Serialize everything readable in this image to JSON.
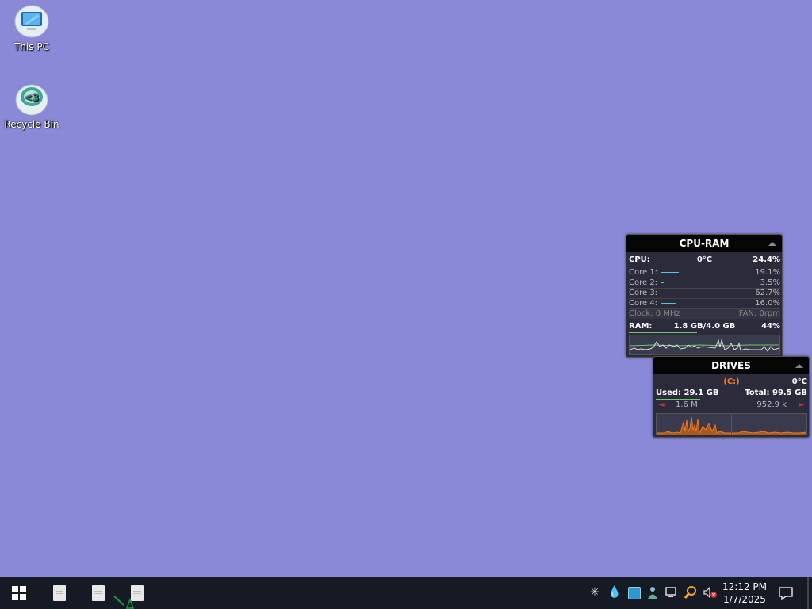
{
  "desktop": {
    "icons": [
      {
        "label": "This PC"
      },
      {
        "label": "Recycle Bin"
      }
    ],
    "background_color": "#8989d8"
  },
  "cpu_ram_gadget": {
    "title": "CPU-RAM",
    "cpu_label": "CPU:",
    "cpu_temp": "0°C",
    "cpu_total": "24.4%",
    "cores": [
      {
        "label": "Core 1:",
        "value": "19.1%",
        "level": 0.191
      },
      {
        "label": "Core 2:",
        "value": "3.5%",
        "level": 0.035
      },
      {
        "label": "Core 3:",
        "value": "62.7%",
        "level": 0.627
      },
      {
        "label": "Core 4:",
        "value": "16.0%",
        "level": 0.16
      }
    ],
    "clock": "Clock: 0 MHz",
    "fan": "FAN: 0rpm",
    "ram_label": "RAM:",
    "ram_usage": "1.8 GB/4.0 GB",
    "ram_percent": "44%"
  },
  "drives_gadget": {
    "title": "DRIVES",
    "drive": "(C:)",
    "temp": "0°C",
    "used": "Used: 29.1 GB",
    "total": "Total: 99.5 GB",
    "read": "1.6 M",
    "write": "952.9 k"
  },
  "taskbar": {
    "time": "12:12 PM",
    "date": "1/7/2025",
    "tray_icons": [
      "network-star-icon",
      "water-drop-icon",
      "app-square-icon",
      "person-icon",
      "network-monitor-icon",
      "search-magnifier-icon",
      "volume-muted-icon"
    ],
    "pinned": [
      "file-icon",
      "file-icon",
      "file-icon"
    ]
  }
}
